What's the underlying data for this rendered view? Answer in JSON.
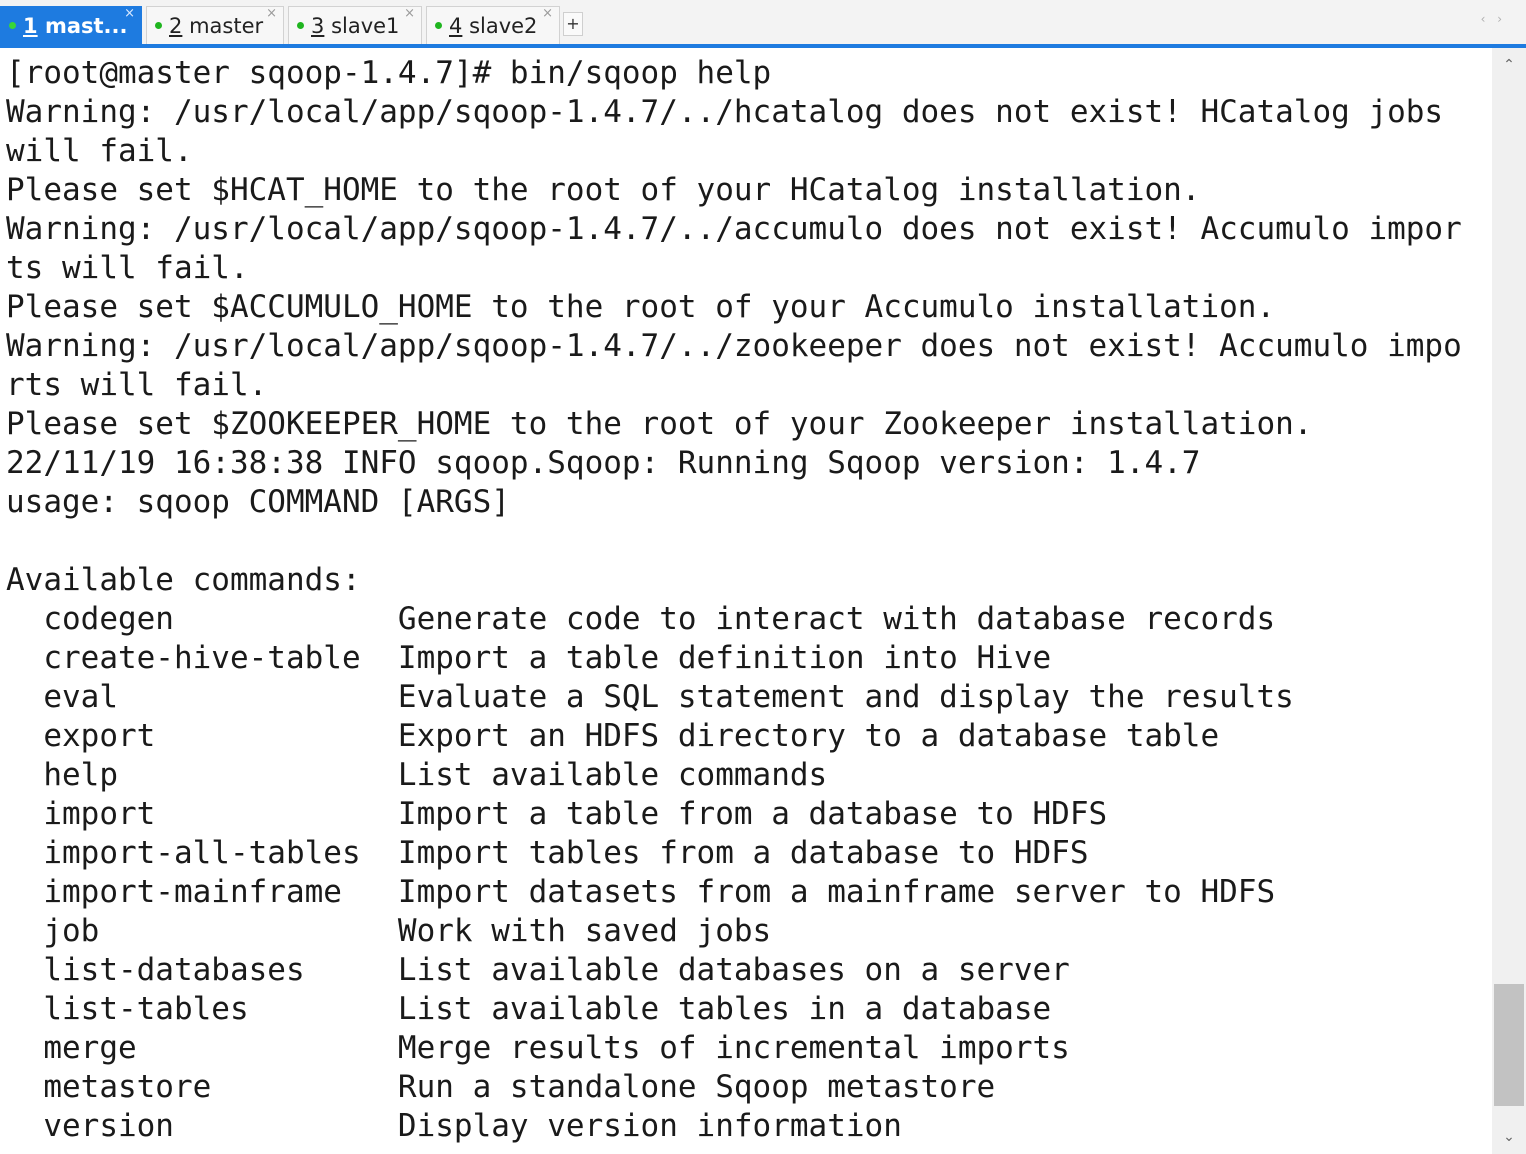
{
  "tabs": [
    {
      "num": "1",
      "label": "mast...",
      "close": "×",
      "active": true
    },
    {
      "num": "2",
      "label": "master",
      "close": "×",
      "active": false
    },
    {
      "num": "3",
      "label": "slave1",
      "close": "×",
      "active": false
    },
    {
      "num": "4",
      "label": "slave2",
      "close": "×",
      "active": false
    }
  ],
  "new_tab_label": "+",
  "nav_arrows": "‹ ›",
  "scrollbar": {
    "up_glyph": "⌃",
    "down_glyph": "⌄"
  },
  "colors": {
    "accent": "#1e7be0",
    "status_dot": "#1fb51f"
  },
  "terminal": {
    "lines": [
      "[root@master sqoop-1.4.7]# bin/sqoop help",
      "Warning: /usr/local/app/sqoop-1.4.7/../hcatalog does not exist! HCatalog jobs",
      "will fail.",
      "Please set $HCAT_HOME to the root of your HCatalog installation.",
      "Warning: /usr/local/app/sqoop-1.4.7/../accumulo does not exist! Accumulo impor",
      "ts will fail.",
      "Please set $ACCUMULO_HOME to the root of your Accumulo installation.",
      "Warning: /usr/local/app/sqoop-1.4.7/../zookeeper does not exist! Accumulo impo",
      "rts will fail.",
      "Please set $ZOOKEEPER_HOME to the root of your Zookeeper installation.",
      "22/11/19 16:38:38 INFO sqoop.Sqoop: Running Sqoop version: 1.4.7",
      "usage: sqoop COMMAND [ARGS]",
      "",
      "Available commands:",
      "  codegen            Generate code to interact with database records",
      "  create-hive-table  Import a table definition into Hive",
      "  eval               Evaluate a SQL statement and display the results",
      "  export             Export an HDFS directory to a database table",
      "  help               List available commands",
      "  import             Import a table from a database to HDFS",
      "  import-all-tables  Import tables from a database to HDFS",
      "  import-mainframe   Import datasets from a mainframe server to HDFS",
      "  job                Work with saved jobs",
      "  list-databases     List available databases on a server",
      "  list-tables        List available tables in a database",
      "  merge              Merge results of incremental imports",
      "  metastore          Run a standalone Sqoop metastore",
      "  version            Display version information"
    ]
  }
}
